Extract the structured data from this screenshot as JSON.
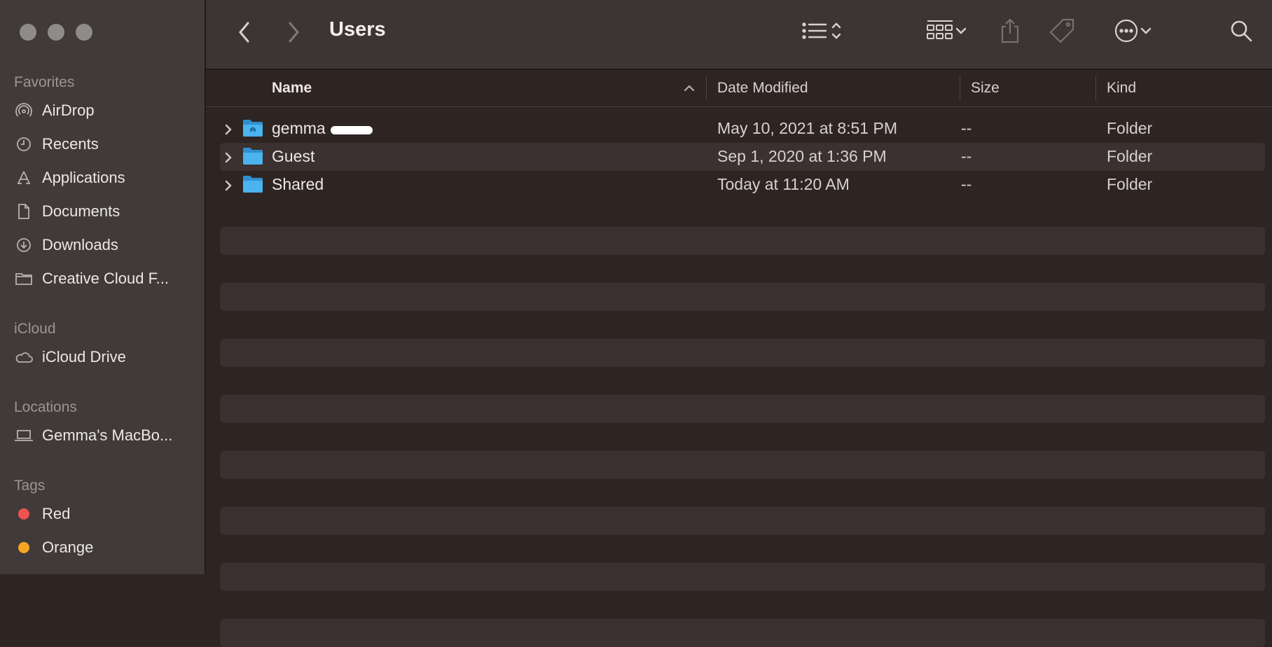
{
  "window": {
    "title": "Users"
  },
  "sidebar": {
    "sections": [
      {
        "heading": "Favorites"
      },
      {
        "heading": "iCloud"
      },
      {
        "heading": "Locations"
      },
      {
        "heading": "Tags"
      }
    ],
    "favorites": [
      {
        "label": "AirDrop",
        "icon": "airdrop-icon"
      },
      {
        "label": "Recents",
        "icon": "clock-icon"
      },
      {
        "label": "Applications",
        "icon": "applications-icon"
      },
      {
        "label": "Documents",
        "icon": "document-icon"
      },
      {
        "label": "Downloads",
        "icon": "download-icon"
      },
      {
        "label": "Creative Cloud F...",
        "icon": "folder-icon"
      }
    ],
    "icloud": [
      {
        "label": "iCloud Drive",
        "icon": "cloud-icon"
      }
    ],
    "locations": [
      {
        "label": "Gemma's MacBo...",
        "icon": "laptop-icon"
      }
    ],
    "tags": [
      {
        "label": "Red",
        "color": "#ee5350"
      },
      {
        "label": "Orange",
        "color": "#f5a623"
      }
    ]
  },
  "columns": {
    "name": "Name",
    "date_modified": "Date Modified",
    "size": "Size",
    "kind": "Kind"
  },
  "files": [
    {
      "name": "gemma",
      "date": "May 10, 2021 at 8:51 PM",
      "size": "--",
      "kind": "Folder",
      "icon": "home-folder-icon"
    },
    {
      "name": "Guest",
      "date": "Sep 1, 2020 at 1:36 PM",
      "size": "--",
      "kind": "Folder",
      "icon": "folder-icon"
    },
    {
      "name": "Shared",
      "date": "Today at 11:20 AM",
      "size": "--",
      "kind": "Folder",
      "icon": "folder-icon"
    }
  ],
  "colors": {
    "folder": "#3aa6e6",
    "accent": "#3aa6e6"
  }
}
